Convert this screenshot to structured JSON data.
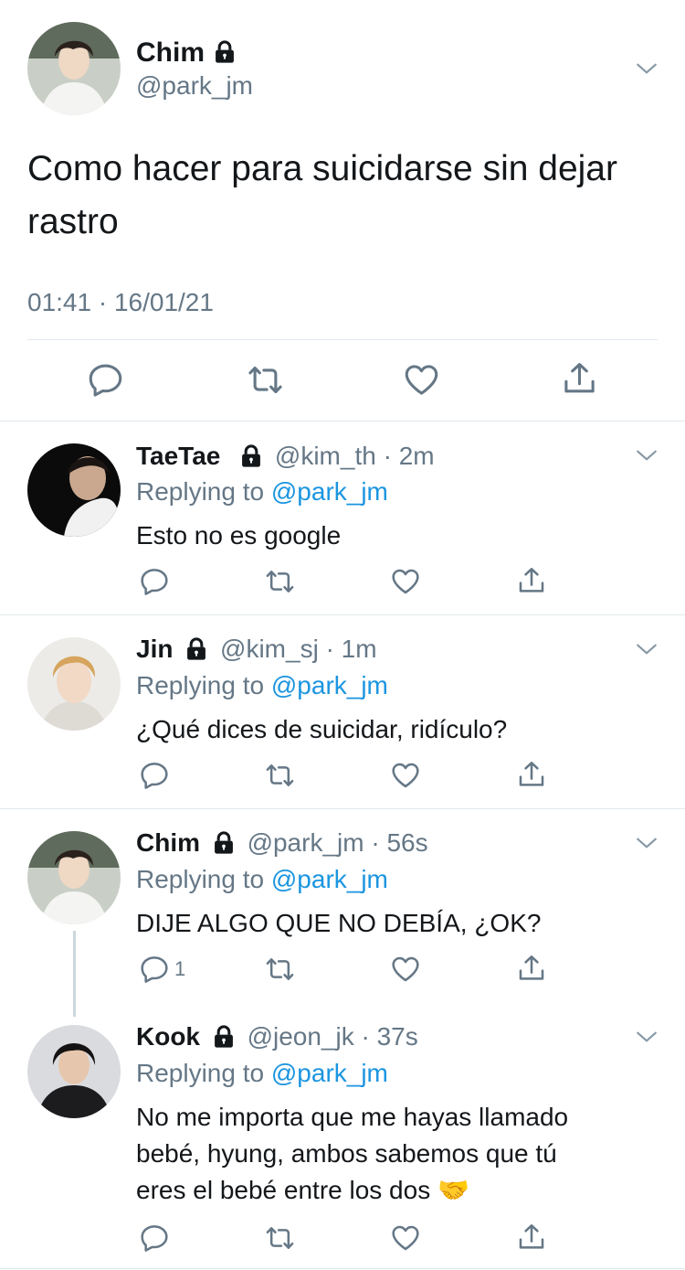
{
  "main_tweet": {
    "name": "Chim",
    "handle": "@park_jm",
    "text_line1": "Como hacer para suicidarse sin dejar",
    "text_line2": "rastro",
    "timestamp": "01:41 · 16/01/21"
  },
  "replies": [
    {
      "name": "TaeTae",
      "handle": "@kim_th",
      "time": "· 2m",
      "replying_prefix": "Replying to",
      "replying_to": "@park_jm",
      "text_lines": [
        "Esto no es google"
      ],
      "reply_count": ""
    },
    {
      "name": "Jin",
      "handle": "@kim_sj",
      "time": "· 1m",
      "replying_prefix": "Replying to",
      "replying_to": "@park_jm",
      "text_lines": [
        "¿Qué dices de suicidar, ridículo?"
      ],
      "reply_count": ""
    },
    {
      "name": "Chim",
      "handle": "@park_jm",
      "time": "· 56s",
      "replying_prefix": "Replying to",
      "replying_to": "@park_jm",
      "text_lines": [
        "DIJE ALGO QUE NO DEBÍA, ¿OK?"
      ],
      "reply_count": "1"
    },
    {
      "name": "Kook",
      "handle": "@jeon_jk",
      "time": "· 37s",
      "replying_prefix": "Replying to",
      "replying_to": "@park_jm",
      "text_lines": [
        "No me importa que me hayas llamado",
        "bebé, hyung, ambos sabemos que tú",
        "eres el bebé entre los dos 🤝"
      ],
      "reply_count": ""
    }
  ],
  "colors": {
    "text": "#14171a",
    "muted": "#657786",
    "link": "#1b95e0",
    "divider": "#e1e8ed"
  },
  "icons": [
    "lock-icon",
    "chevron-down-icon",
    "reply-icon",
    "retweet-icon",
    "like-icon",
    "share-icon"
  ]
}
